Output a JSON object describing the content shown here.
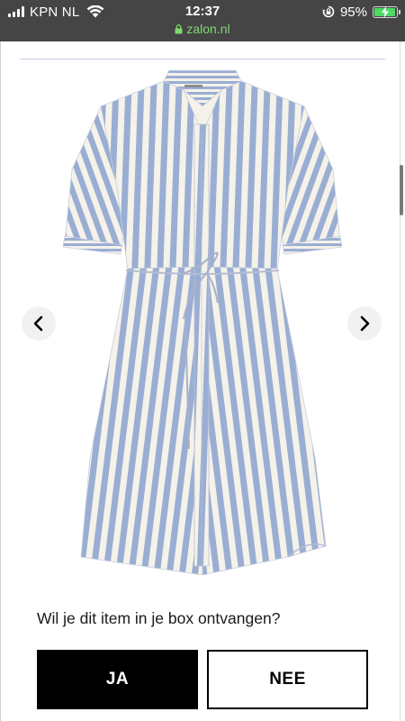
{
  "status_bar": {
    "carrier": "KPN NL",
    "time": "12:37",
    "battery_percent": "95%",
    "battery_level": 0.95,
    "url": "zalon.nl",
    "icons": [
      "signal-icon",
      "wifi-icon",
      "orientation-lock-icon",
      "battery-icon",
      "lock-icon"
    ]
  },
  "product": {
    "image_icon": "striped-shirt-dress",
    "stripe_colors": [
      "#9aaed3",
      "#f5f2ea"
    ]
  },
  "carousel": {
    "prev_icon": "chevron-left-icon",
    "next_icon": "chevron-right-icon"
  },
  "prompt": {
    "question": "Wil je dit item in je box ontvangen?",
    "yes_label": "JA",
    "no_label": "NEE"
  },
  "colors": {
    "statusbar_bg": "#454545",
    "url_green": "#7fd870",
    "battery_green": "#4cd964",
    "button_black": "#000000"
  }
}
